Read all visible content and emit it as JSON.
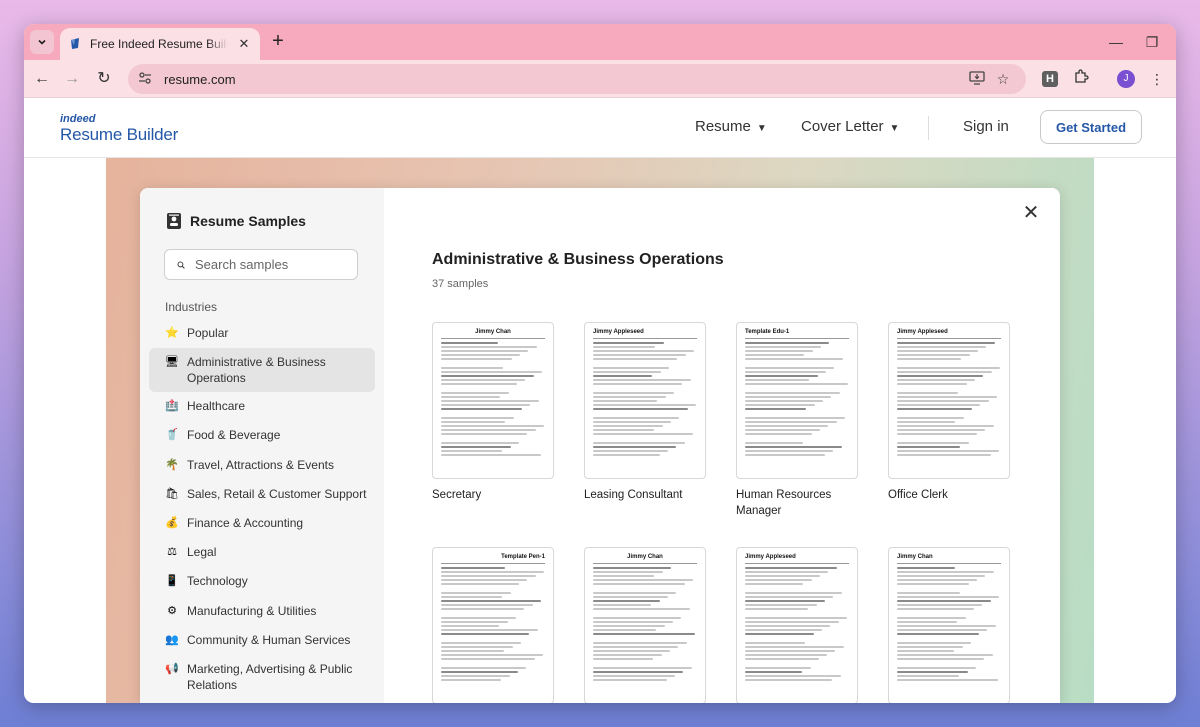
{
  "browser": {
    "tab_title": "Free Indeed Resume Builder - C",
    "new_tab_symbol": "+",
    "url": "resume.com",
    "profile_initial": "J",
    "extension_letter": "H"
  },
  "site": {
    "logo_small": "indeed",
    "logo_main": "Resume Builder",
    "nav": [
      "Resume",
      "Cover Letter"
    ],
    "sign_in": "Sign in",
    "get_started": "Get Started",
    "brand_color": "#2557a7"
  },
  "modal": {
    "title": "Resume Samples",
    "search_placeholder": "Search samples",
    "industries_label": "Industries",
    "industries": [
      {
        "label": "Popular",
        "icon": "star-icon",
        "glyph": "⭐"
      },
      {
        "label": "Administrative & Business Operations",
        "icon": "computer-icon",
        "glyph": "🖥",
        "active": true
      },
      {
        "label": "Healthcare",
        "icon": "hospital-icon",
        "glyph": "🏥"
      },
      {
        "label": "Food & Beverage",
        "icon": "drink-icon",
        "glyph": "🥤"
      },
      {
        "label": "Travel, Attractions & Events",
        "icon": "palm-tree-icon",
        "glyph": "🌴"
      },
      {
        "label": "Sales, Retail & Customer Support",
        "icon": "shopping-bags-icon",
        "glyph": "🛍"
      },
      {
        "label": "Finance & Accounting",
        "icon": "money-bag-icon",
        "glyph": "💰"
      },
      {
        "label": "Legal",
        "icon": "scales-icon",
        "glyph": "⚖"
      },
      {
        "label": "Technology",
        "icon": "phone-icon",
        "glyph": "📱"
      },
      {
        "label": "Manufacturing & Utilities",
        "icon": "gear-icon",
        "glyph": "⚙"
      },
      {
        "label": "Community & Human Services",
        "icon": "people-icon",
        "glyph": "👥"
      },
      {
        "label": "Marketing, Advertising & Public Relations",
        "icon": "megaphone-icon",
        "glyph": "📢"
      }
    ],
    "main_title": "Administrative & Business Operations",
    "sample_count": "37 samples",
    "samples": [
      {
        "label": "Secretary",
        "thumb_name": "Jimmy Chan",
        "style": "center"
      },
      {
        "label": "Leasing Consultant",
        "thumb_name": "Jimmy Appleseed",
        "style": "left"
      },
      {
        "label": "Human Resources Manager",
        "thumb_name": "Template Edu-1",
        "style": "template"
      },
      {
        "label": "Office Clerk",
        "thumb_name": "Jimmy Appleseed",
        "style": "left"
      },
      {
        "label": "",
        "thumb_name": "Template Pen-1",
        "style": "template-right"
      },
      {
        "label": "",
        "thumb_name": "Jimmy Chan",
        "style": "center"
      },
      {
        "label": "",
        "thumb_name": "Jimmy Appleseed",
        "style": "left"
      },
      {
        "label": "",
        "thumb_name": "Jimmy Chan",
        "style": "letter"
      }
    ]
  }
}
